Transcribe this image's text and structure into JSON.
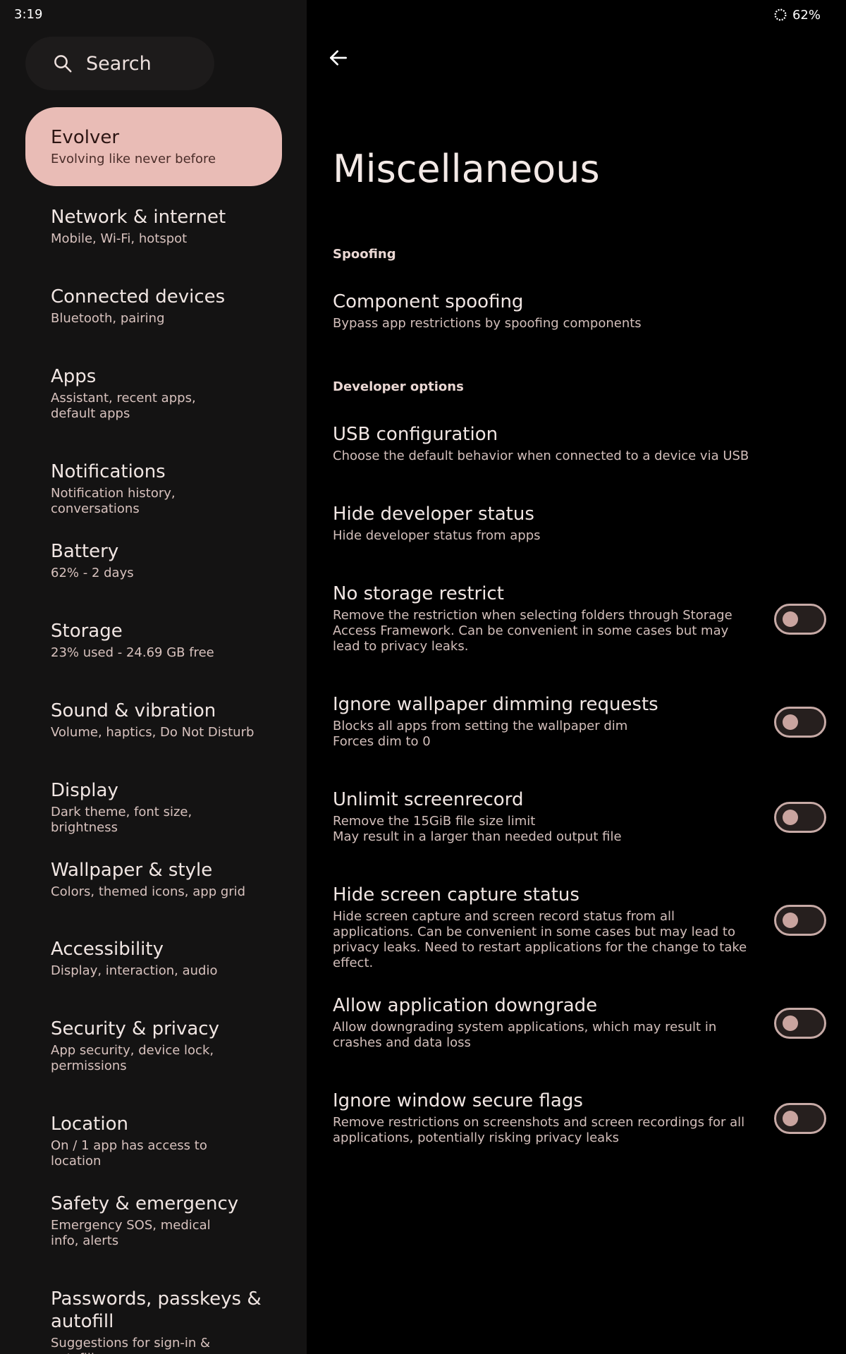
{
  "status": {
    "time": "3:19",
    "battery": "62%"
  },
  "sidebar": {
    "search_label": "Search",
    "items": [
      {
        "title": "Evolver",
        "subtitle": "Evolving like never before"
      },
      {
        "title": "Network & internet",
        "subtitle": "Mobile, Wi-Fi, hotspot"
      },
      {
        "title": "Connected devices",
        "subtitle": "Bluetooth, pairing"
      },
      {
        "title": "Apps",
        "subtitle": "Assistant, recent apps, default apps"
      },
      {
        "title": "Notifications",
        "subtitle": "Notification history, conversations"
      },
      {
        "title": "Battery",
        "subtitle": "62% - 2 days"
      },
      {
        "title": "Storage",
        "subtitle": "23% used - 24.69 GB free"
      },
      {
        "title": "Sound & vibration",
        "subtitle": "Volume, haptics, Do Not Disturb"
      },
      {
        "title": "Display",
        "subtitle": "Dark theme, font size, brightness"
      },
      {
        "title": "Wallpaper & style",
        "subtitle": "Colors, themed icons, app grid"
      },
      {
        "title": "Accessibility",
        "subtitle": "Display, interaction, audio"
      },
      {
        "title": "Security & privacy",
        "subtitle": "App security, device lock, permissions"
      },
      {
        "title": "Location",
        "subtitle": "On / 1 app has access to location"
      },
      {
        "title": "Safety & emergency",
        "subtitle": "Emergency SOS, medical info, alerts"
      },
      {
        "title": "Passwords, passkeys & autofill",
        "subtitle": "Suggestions for sign-in & autofill"
      }
    ]
  },
  "main": {
    "title": "Miscellaneous",
    "sections": {
      "spoofing": "Spoofing",
      "developer": "Developer options"
    },
    "prefs": [
      {
        "title": "Component spoofing",
        "subtitle": "Bypass app restrictions by spoofing components"
      },
      {
        "title": "USB configuration",
        "subtitle": "Choose the default behavior when connected to a device via USB"
      },
      {
        "title": "Hide developer status",
        "subtitle": "Hide developer status from apps"
      },
      {
        "title": "No storage restrict",
        "subtitle": "Remove the restriction when selecting folders through Storage Access Framework. Can be convenient in some cases but may lead to privacy leaks.",
        "enabled": false
      },
      {
        "title": "Ignore wallpaper dimming requests",
        "subtitle": "Blocks all apps from setting the wallpaper dim",
        "subtitle2": "Forces dim to 0",
        "enabled": false
      },
      {
        "title": "Unlimit screenrecord",
        "subtitle": "Remove the 15GiB file size limit",
        "subtitle2": "May result in a larger than needed output file",
        "enabled": false
      },
      {
        "title": "Hide screen capture status",
        "subtitle": "Hide screen capture and screen record status from all applications. Can be convenient in some cases but may lead to privacy leaks. Need to restart applications for the change to take effect.",
        "enabled": false
      },
      {
        "title": "Allow application downgrade",
        "subtitle": "Allow downgrading system applications, which may result in crashes and data loss",
        "enabled": false
      },
      {
        "title": "Ignore window secure flags",
        "subtitle": "Remove restrictions on screenshots and screen recordings for all applications, potentially risking privacy leaks",
        "enabled": false
      }
    ]
  },
  "colors": {
    "active_item_bg": "#e9bcb6",
    "sidebar_bg": "#141313",
    "toggle_outline": "#c7aaa6"
  }
}
